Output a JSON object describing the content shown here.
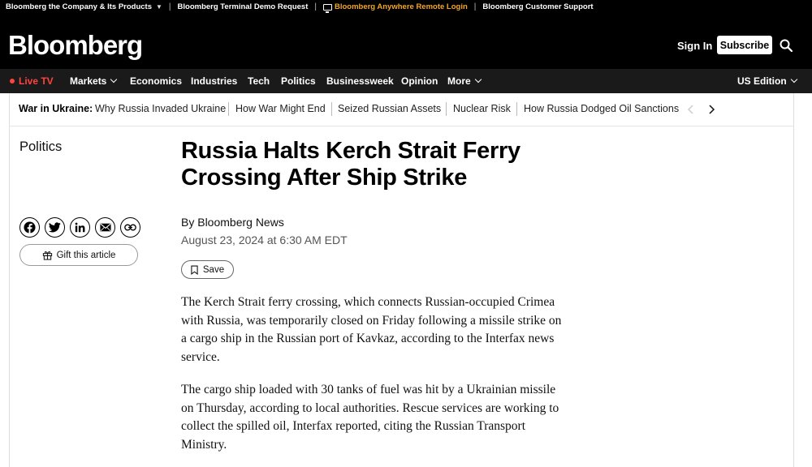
{
  "utility_bar": {
    "items": [
      "Bloomberg the Company & Its Products",
      "Bloomberg Terminal Demo Request",
      "Bloomberg Anywhere Remote Login",
      "Bloomberg Customer Support"
    ],
    "highlight_color": "#f5a623"
  },
  "masthead": {
    "logo": "Bloomberg",
    "sign_in": "Sign In",
    "subscribe": "Subscribe",
    "search_icon": "search-icon"
  },
  "nav": {
    "live": "Live TV",
    "items": [
      "Markets",
      "Economics",
      "Industries",
      "Tech",
      "Politics",
      "Businessweek",
      "Opinion",
      "More"
    ],
    "edition": "US Edition",
    "live_color": "#ff433d"
  },
  "ticker": {
    "lead": "War in Ukraine:",
    "links": [
      "Why Russia Invaded Ukraine",
      "How War Might End",
      "Seized Russian Assets",
      "Nuclear Risk",
      "How Russia Dodged Oil Sanctions"
    ]
  },
  "article": {
    "section": "Politics",
    "headline": "Russia Halts Kerch Strait Ferry Crossing After Ship Strike",
    "byline": "By Bloomberg News",
    "date": "August 23, 2024 at 6:30 AM EDT",
    "save": "Save",
    "gift": "Gift this article",
    "share_icons": [
      "facebook-icon",
      "twitter-icon",
      "linkedin-icon",
      "email-icon",
      "link-icon"
    ],
    "paragraphs": [
      "The Kerch Strait ferry crossing, which connects Russian-occupied Crimea with Russia, was temporarily closed on Friday following a missile strike on a cargo ship in the Russian port of Kavkaz, according to the Interfax news service.",
      "The cargo ship loaded with 30 tanks of fuel was hit by a Ukrainian missile on Thursday, according to local authorities. Rescue services are working to collect the spilled oil, Interfax reported, citing the Russian Transport Ministry."
    ]
  }
}
